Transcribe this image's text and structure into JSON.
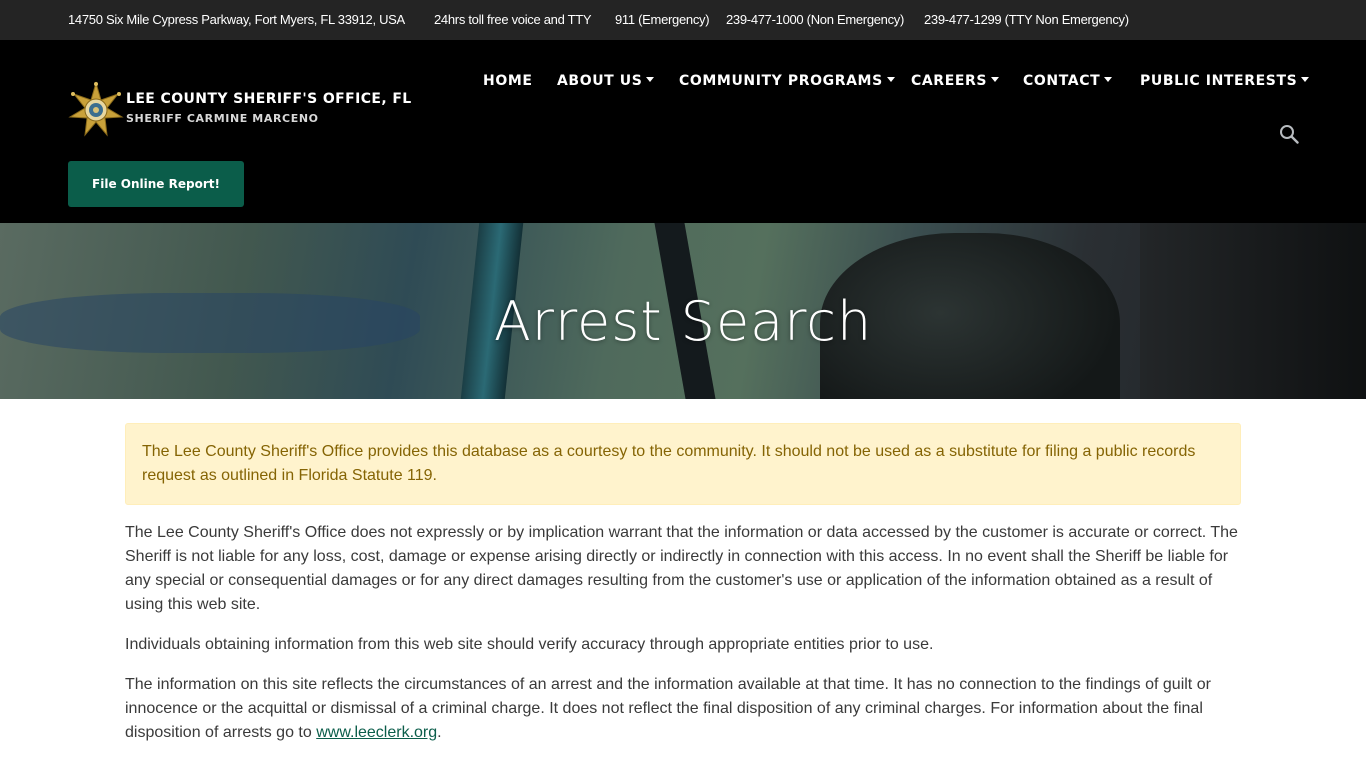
{
  "topbar": {
    "address": "14750 Six Mile Cypress Parkway, Fort Myers, FL 33912, USA",
    "tty": "24hrs toll free voice and TTY",
    "emergency": "911 (Emergency)",
    "non_emergency": "239-477-1000 (Non Emergency)",
    "tty_non_emergency": "239-477-1299 (TTY Non Emergency)"
  },
  "brand": {
    "title": "LEE COUNTY SHERIFF'S OFFICE, FL",
    "subtitle": "SHERIFF CARMINE MARCENO",
    "logo_icon": "sheriff-star-badge-icon",
    "gold": "#c9a13a"
  },
  "nav": {
    "home": "HOME",
    "about": "ABOUT US",
    "community": "COMMUNITY PROGRAMS",
    "careers": "CAREERS",
    "contact": "CONTACT",
    "public": "PUBLIC INTERESTS"
  },
  "report_button": "File Online Report!",
  "accent_color": "#0b5d4a",
  "hero": {
    "title": "Arrest Search"
  },
  "notice": "The Lee County Sheriff's Office provides this database as a courtesy to the community. It should not be used as a substitute for filing a public records request as outlined in Florida Statute 119.",
  "disclaimer": {
    "p1": "The Lee County Sheriff's Office does not expressly or by implication warrant that the information or data accessed by the customer is accurate or correct. The Sheriff is not liable for any loss, cost, damage or expense arising directly or indirectly in connection with this access. In no event shall the Sheriff be liable for any special or consequential damages or for any direct damages resulting from the customer's use or application of the information obtained as a result of using this web site.",
    "p2": "Individuals obtaining information from this web site should verify accuracy through appropriate entities prior to use.",
    "p3_text": "The information on this site reflects the circumstances of an arrest and the information available at that time. It has no connection to the findings of guilt or innocence or the acquittal or dismissal of a criminal charge. It does not reflect the final disposition of any criminal charges. For information about the final disposition of arrests go to ",
    "p3_link": "www.leeclerk.org",
    "p3_end": "."
  }
}
